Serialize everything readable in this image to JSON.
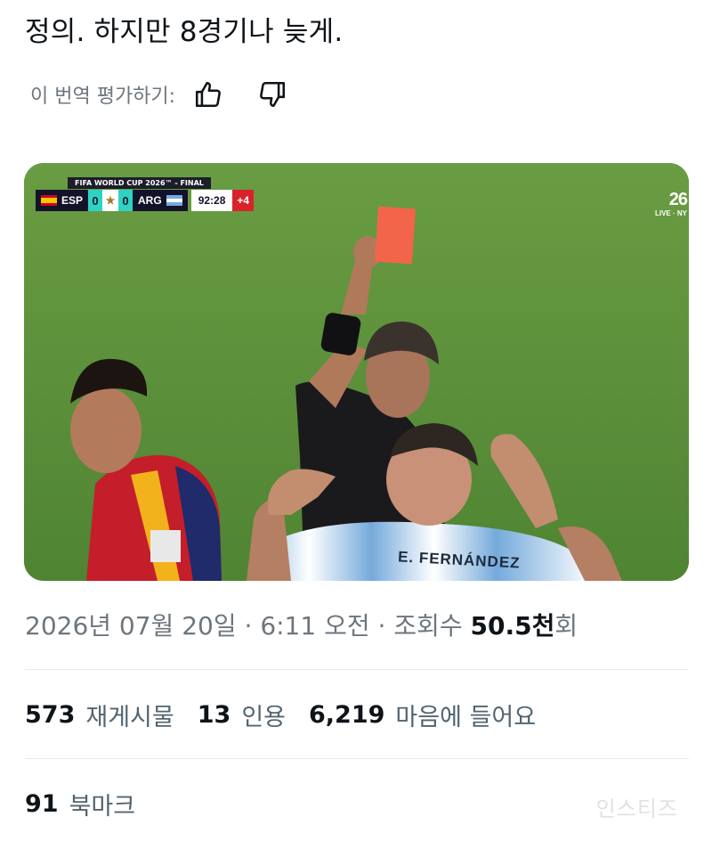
{
  "tweet": {
    "text": "정의. 하지만 8경기나 늦게."
  },
  "translation_rating": {
    "label": "이 번역 평가하기:",
    "thumbs_up_icon": "thumbs-up-icon",
    "thumbs_down_icon": "thumbs-down-icon"
  },
  "media": {
    "scorebug": {
      "title": "FIFA WORLD CUP 2026™ - FINAL",
      "home_team": "ESP",
      "home_score": "0",
      "away_score": "0",
      "away_team": "ARG",
      "clock": "92:28",
      "added_time": "+4"
    },
    "broadcaster": {
      "logo": "26",
      "live": "LIVE · NY"
    },
    "jersey_name": "E. FERNÁNDEZ",
    "colors": {
      "pitch": "#5c8f3a",
      "red_card": "#f2654a"
    }
  },
  "meta": {
    "date": "2026년 07월 20일",
    "separator": " · ",
    "time": "6:11 오전",
    "views_label": "조회수",
    "views_value": "50.5",
    "views_unit": "천",
    "views_suffix": "회"
  },
  "stats": {
    "retweets": {
      "count": "573",
      "label": "재게시물"
    },
    "quotes": {
      "count": "13",
      "label": "인용"
    },
    "likes": {
      "count": "6,219",
      "label": "마음에 들어요"
    },
    "bookmarks": {
      "count": "91",
      "label": "북마크"
    }
  },
  "watermark": "인스티즈"
}
